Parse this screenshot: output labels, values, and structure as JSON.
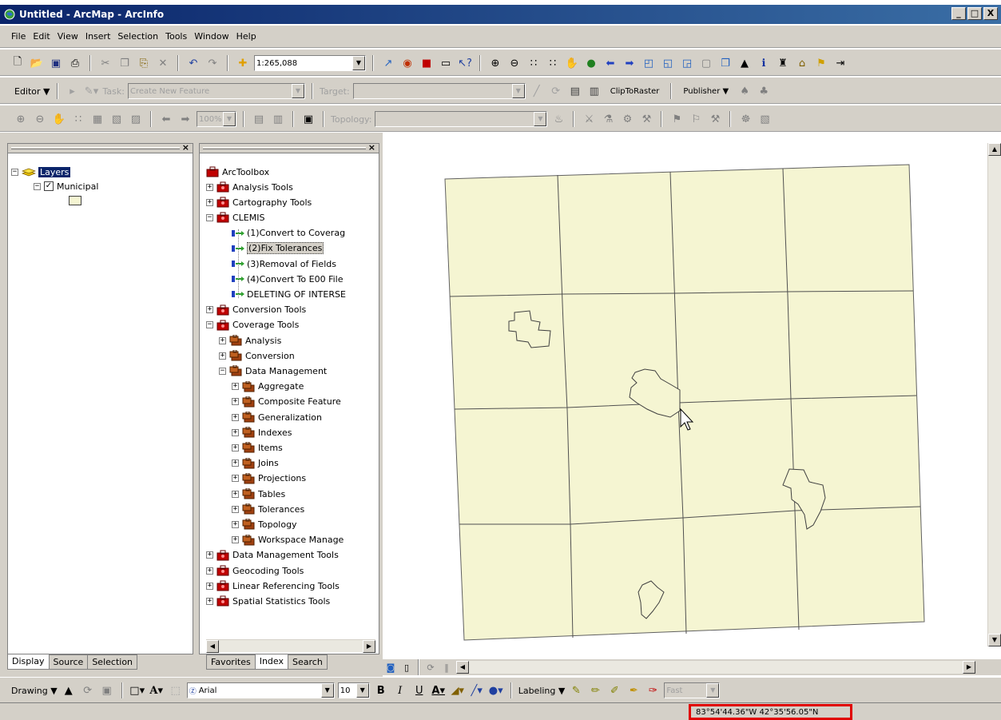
{
  "window": {
    "title": "Untitled - ArcMap - ArcInfo",
    "buttons": [
      "_",
      "□",
      "X"
    ]
  },
  "menu": [
    "File",
    "Edit",
    "View",
    "Insert",
    "Selection",
    "Tools",
    "Window",
    "Help"
  ],
  "standard_toolbar": {
    "scale_value": "1:265,088"
  },
  "editor_toolbar": {
    "editor_label": "Editor ▼",
    "task_label": "Task:",
    "task_value": "Create New Feature",
    "target_label": "Target:",
    "target_value": "",
    "cliptoraster_label": "ClipToRaster",
    "publisher_label": "Publisher ▼"
  },
  "topology_toolbar": {
    "zoom_value": "100%",
    "topology_label": "Topology:",
    "topology_value": ""
  },
  "toc": {
    "root": "Layers",
    "layer": "Municipal",
    "tabs": [
      "Display",
      "Source",
      "Selection"
    ],
    "swatch_color": "#f5f5d2"
  },
  "toolbox": {
    "root": "ArcToolbox",
    "items": [
      {
        "label": "Analysis Tools",
        "level": 1,
        "kind": "toolbox",
        "exp": "+"
      },
      {
        "label": "Cartography Tools",
        "level": 1,
        "kind": "toolbox",
        "exp": "+"
      },
      {
        "label": "CLEMIS",
        "level": 1,
        "kind": "toolbox",
        "exp": "-"
      },
      {
        "label": "(1)Convert to Coverag",
        "level": 2,
        "kind": "tool",
        "exp": ""
      },
      {
        "label": "(2)Fix Tolerances",
        "level": 2,
        "kind": "tool",
        "exp": "",
        "selected": true
      },
      {
        "label": "(3)Removal of Fields",
        "level": 2,
        "kind": "tool",
        "exp": ""
      },
      {
        "label": "(4)Convert To E00 File",
        "level": 2,
        "kind": "tool",
        "exp": ""
      },
      {
        "label": "DELETING OF INTERSE",
        "level": 2,
        "kind": "tool",
        "exp": ""
      },
      {
        "label": "Conversion Tools",
        "level": 1,
        "kind": "toolbox",
        "exp": "+"
      },
      {
        "label": "Coverage Tools",
        "level": 1,
        "kind": "toolbox",
        "exp": "-"
      },
      {
        "label": "Analysis",
        "level": 2,
        "kind": "toolset",
        "exp": "+"
      },
      {
        "label": "Conversion",
        "level": 2,
        "kind": "toolset",
        "exp": "+"
      },
      {
        "label": "Data Management",
        "level": 2,
        "kind": "toolset",
        "exp": "-"
      },
      {
        "label": "Aggregate",
        "level": 3,
        "kind": "toolset",
        "exp": "+"
      },
      {
        "label": "Composite Feature",
        "level": 3,
        "kind": "toolset",
        "exp": "+"
      },
      {
        "label": "Generalization",
        "level": 3,
        "kind": "toolset",
        "exp": "+"
      },
      {
        "label": "Indexes",
        "level": 3,
        "kind": "toolset",
        "exp": "+"
      },
      {
        "label": "Items",
        "level": 3,
        "kind": "toolset",
        "exp": "+"
      },
      {
        "label": "Joins",
        "level": 3,
        "kind": "toolset",
        "exp": "+"
      },
      {
        "label": "Projections",
        "level": 3,
        "kind": "toolset",
        "exp": "+"
      },
      {
        "label": "Tables",
        "level": 3,
        "kind": "toolset",
        "exp": "+"
      },
      {
        "label": "Tolerances",
        "level": 3,
        "kind": "toolset",
        "exp": "+"
      },
      {
        "label": "Topology",
        "level": 3,
        "kind": "toolset",
        "exp": "+"
      },
      {
        "label": "Workspace Manage",
        "level": 3,
        "kind": "toolset",
        "exp": "+"
      },
      {
        "label": "Data Management Tools",
        "level": 1,
        "kind": "toolbox",
        "exp": "+"
      },
      {
        "label": "Geocoding Tools",
        "level": 1,
        "kind": "toolbox",
        "exp": "+"
      },
      {
        "label": "Linear Referencing Tools",
        "level": 1,
        "kind": "toolbox",
        "exp": "+"
      },
      {
        "label": "Spatial Statistics Tools",
        "level": 1,
        "kind": "toolbox",
        "exp": "+"
      }
    ],
    "tabs": [
      "Favorites",
      "Index",
      "Search"
    ]
  },
  "map": {
    "fill_color": "#f5f5d2"
  },
  "drawing_toolbar": {
    "drawing_label": "Drawing ▼",
    "font_value": "Arial",
    "font_size": "10",
    "bold": "B",
    "italic": "I",
    "underline": "U",
    "labeling_label": "Labeling ▼",
    "fast_value": "Fast"
  },
  "status": {
    "coordinates": "83°54'44.36\"W  42°35'56.05\"N"
  }
}
